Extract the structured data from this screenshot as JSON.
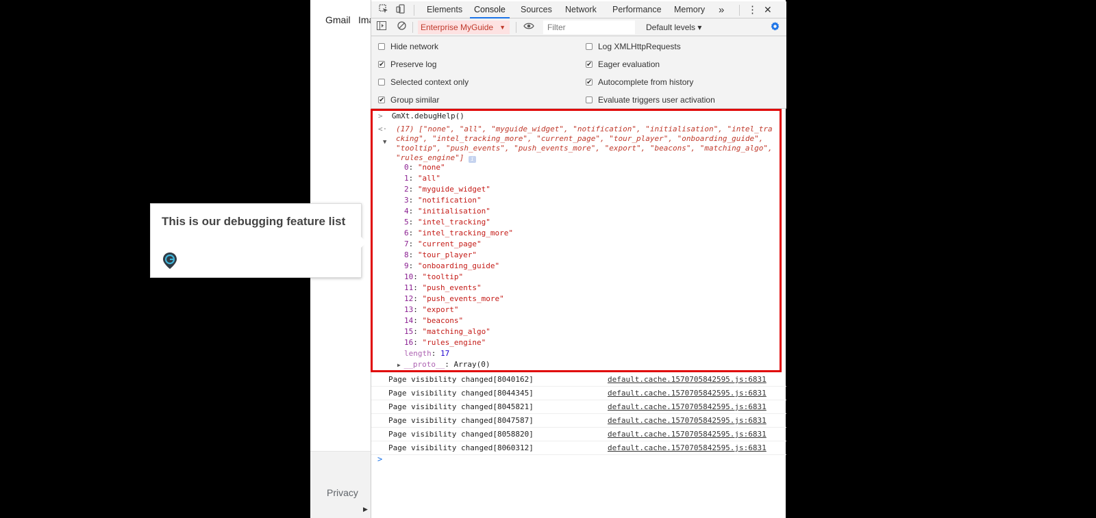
{
  "page": {
    "gmail_label": "Gmail",
    "images_label": "Ima",
    "privacy_label": "Privacy",
    "scroll_arrow": "▶"
  },
  "tooltip": {
    "title": "This is our debugging feature list",
    "icon": "myguide-pin-icon"
  },
  "devtools": {
    "tabs": [
      "Elements",
      "Console",
      "Sources",
      "Network",
      "Performance",
      "Memory"
    ],
    "active_tab": "Console",
    "more_tabs": "»",
    "menu": "⋮",
    "close": "✕",
    "context": "Enterprise MyGuide",
    "filter_placeholder": "Filter",
    "levels": "Default levels ▾",
    "settings": {
      "left": [
        {
          "label": "Hide network",
          "checked": false
        },
        {
          "label": "Preserve log",
          "checked": true
        },
        {
          "label": "Selected context only",
          "checked": false
        },
        {
          "label": "Group similar",
          "checked": true
        }
      ],
      "right": [
        {
          "label": "Log XMLHttpRequests",
          "checked": false
        },
        {
          "label": "Eager evaluation",
          "checked": true
        },
        {
          "label": "Autocomplete from history",
          "checked": true
        },
        {
          "label": "Evaluate triggers user activation",
          "checked": false
        }
      ]
    }
  },
  "console": {
    "command": "GmXt.debugHelp()",
    "summary_lines": [
      "(17) [\"none\", \"all\", \"myguide_widget\", \"notification\", \"initialisation\", \"intel_tra",
      "cking\", \"intel_tracking_more\", \"current_page\", \"tour_player\", \"onboarding_guide\",",
      "\"tooltip\", \"push_events\", \"push_events_more\", \"export\", \"beacons\", \"matching_algo\",",
      "\"rules_engine\"]"
    ],
    "items": [
      {
        "index": "0",
        "value": "\"none\""
      },
      {
        "index": "1",
        "value": "\"all\""
      },
      {
        "index": "2",
        "value": "\"myguide_widget\""
      },
      {
        "index": "3",
        "value": "\"notification\""
      },
      {
        "index": "4",
        "value": "\"initialisation\""
      },
      {
        "index": "5",
        "value": "\"intel_tracking\""
      },
      {
        "index": "6",
        "value": "\"intel_tracking_more\""
      },
      {
        "index": "7",
        "value": "\"current_page\""
      },
      {
        "index": "8",
        "value": "\"tour_player\""
      },
      {
        "index": "9",
        "value": "\"onboarding_guide\""
      },
      {
        "index": "10",
        "value": "\"tooltip\""
      },
      {
        "index": "11",
        "value": "\"push_events\""
      },
      {
        "index": "12",
        "value": "\"push_events_more\""
      },
      {
        "index": "13",
        "value": "\"export\""
      },
      {
        "index": "14",
        "value": "\"beacons\""
      },
      {
        "index": "15",
        "value": "\"matching_algo\""
      },
      {
        "index": "16",
        "value": "\"rules_engine\""
      }
    ],
    "length_key": "length",
    "length_value": "17",
    "proto_key": "__proto__",
    "proto_value": "Array(0)",
    "logs": [
      {
        "message": "Page visibility changed[8040162]",
        "source": "default.cache.1570705842595.js:6831"
      },
      {
        "message": "Page visibility changed[8044345]",
        "source": "default.cache.1570705842595.js:6831"
      },
      {
        "message": "Page visibility changed[8045821]",
        "source": "default.cache.1570705842595.js:6831"
      },
      {
        "message": "Page visibility changed[8047587]",
        "source": "default.cache.1570705842595.js:6831"
      },
      {
        "message": "Page visibility changed[8058820]",
        "source": "default.cache.1570705842595.js:6831"
      },
      {
        "message": "Page visibility changed[8060312]",
        "source": "default.cache.1570705842595.js:6831"
      }
    ]
  },
  "colors": {
    "highlight": "#e00000",
    "accent": "#1a73e8",
    "string": "#c41a16",
    "key": "#8a1f91"
  }
}
